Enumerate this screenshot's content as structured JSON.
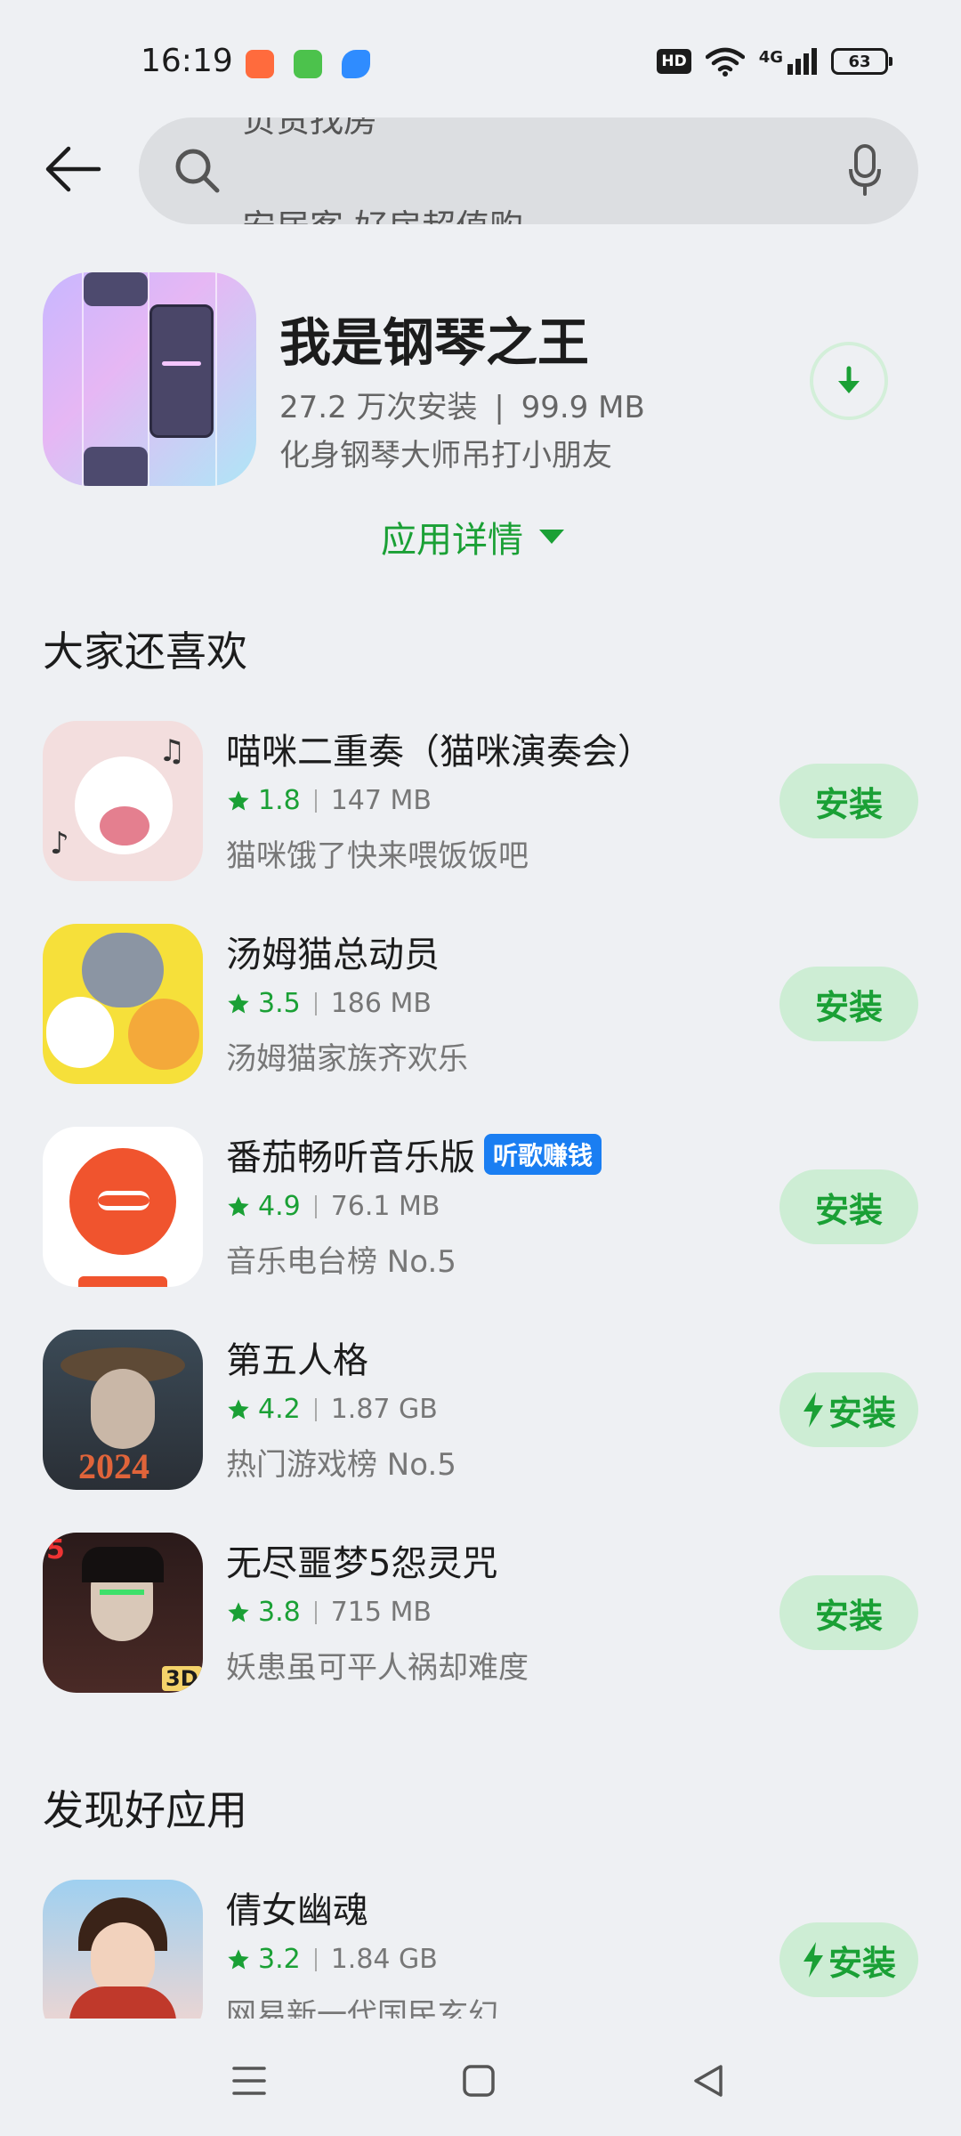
{
  "status": {
    "time": "16:19",
    "hd": "HD",
    "network": "4G",
    "battery": "63"
  },
  "search": {
    "suggest_prev": "负责找房",
    "suggest_next": "安居客 好房超值购"
  },
  "app": {
    "name": "我是钢琴之王",
    "installs": "27.2 万次安装",
    "size": "99.9 MB",
    "desc": "化身钢琴大师吊打小朋友",
    "details_label": "应用详情"
  },
  "sections": {
    "also_like": "大家还喜欢",
    "discover": "发现好应用"
  },
  "recommend": [
    {
      "name": "喵咪二重奏（猫咪演奏会）",
      "rating": "1.8",
      "size": "147 MB",
      "desc": "猫咪饿了快来喂饭饭吧",
      "button": "安装",
      "fast": false,
      "badge": ""
    },
    {
      "name": "汤姆猫总动员",
      "rating": "3.5",
      "size": "186 MB",
      "desc": "汤姆猫家族齐欢乐",
      "button": "安装",
      "fast": false,
      "badge": ""
    },
    {
      "name": "番茄畅听音乐版",
      "rating": "4.9",
      "size": "76.1 MB",
      "desc": "音乐电台榜 No.5",
      "button": "安装",
      "fast": false,
      "badge": "听歌赚钱"
    },
    {
      "name": "第五人格",
      "rating": "4.2",
      "size": "1.87 GB",
      "desc": "热门游戏榜 No.5",
      "button": "安装",
      "fast": true,
      "badge": ""
    },
    {
      "name": "无尽噩梦5怨灵咒",
      "rating": "3.8",
      "size": "715 MB",
      "desc": "妖患虽可平人祸却难度",
      "button": "安装",
      "fast": false,
      "badge": ""
    }
  ],
  "discover": [
    {
      "name": "倩女幽魂",
      "rating": "3.2",
      "size": "1.84 GB",
      "desc": "网易新一代国民玄幻",
      "button": "安装",
      "fast": true
    }
  ],
  "icons": {
    "back": "arrow-left",
    "search": "magnifier",
    "mic": "microphone",
    "download": "arrow-down",
    "star": "star",
    "fast": "lightning"
  },
  "colors": {
    "accent": "#1aa035",
    "button_bg": "#cdedd4",
    "badge": "#1a7ef2"
  }
}
